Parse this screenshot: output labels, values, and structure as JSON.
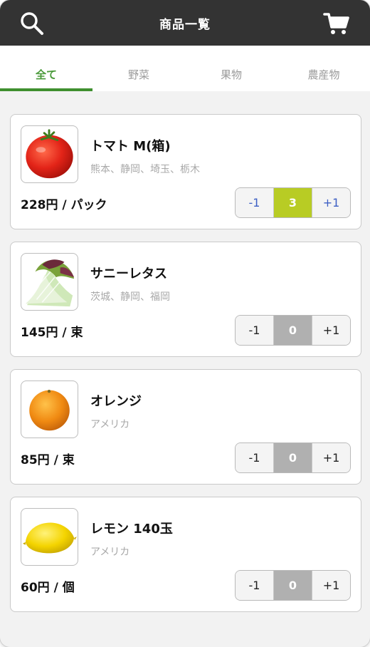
{
  "header": {
    "title": "商品一覧",
    "search_icon": "search-icon",
    "cart_icon": "cart-icon"
  },
  "tabs": [
    {
      "label": "全て",
      "active": true
    },
    {
      "label": "野菜",
      "active": false
    },
    {
      "label": "果物",
      "active": false
    },
    {
      "label": "農産物",
      "active": false
    }
  ],
  "products": [
    {
      "name": "トマト M(箱)",
      "origin": "熊本、静岡、埼玉、栃木",
      "price": "228円 / パック",
      "quantity": "3",
      "decrement_label": "-1",
      "increment_label": "+1",
      "image": "tomato-image"
    },
    {
      "name": "サニーレタス",
      "origin": "茨城、静岡、福岡",
      "price": "145円 / 束",
      "quantity": "0",
      "decrement_label": "-1",
      "increment_label": "+1",
      "image": "lettuce-image"
    },
    {
      "name": "オレンジ",
      "origin": "アメリカ",
      "price": "85円 / 束",
      "quantity": "0",
      "decrement_label": "-1",
      "increment_label": "+1",
      "image": "orange-image"
    },
    {
      "name": "レモン 140玉",
      "origin": "アメリカ",
      "price": "60円 / 個",
      "quantity": "0",
      "decrement_label": "-1",
      "increment_label": "+1",
      "image": "lemon-image"
    }
  ],
  "colors": {
    "header_bg": "#333333",
    "accent_green": "#3f8f2f",
    "selected_count": "#b8cc24",
    "stepper_blue": "#3d5fc4"
  }
}
